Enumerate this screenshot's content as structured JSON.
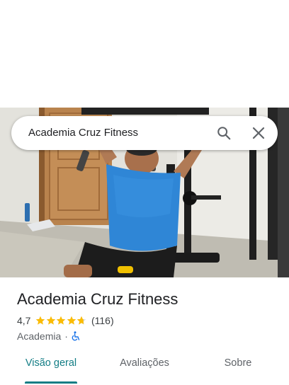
{
  "search": {
    "query": "Academia Cruz Fitness"
  },
  "photo": {
    "subject": "Person training on shoulder press machine"
  },
  "place": {
    "name": "Academia Cruz Fitness",
    "rating_text": "4,7",
    "rating_value": 4.7,
    "rating_max": 5,
    "review_count": "(116)",
    "category": "Academia",
    "separator": "·"
  },
  "tabs": [
    {
      "label": "Visão geral",
      "active": true
    },
    {
      "label": "Avaliações",
      "active": false
    },
    {
      "label": "Sobre",
      "active": false
    }
  ],
  "colors": {
    "accent": "#137d85",
    "star": "#fbbc04",
    "star_empty": "#dadce0",
    "accessibility": "#1a73e8"
  },
  "icons": {
    "search": "search-icon",
    "close": "close-icon",
    "star": "star-icon",
    "accessibility": "wheelchair-icon"
  }
}
